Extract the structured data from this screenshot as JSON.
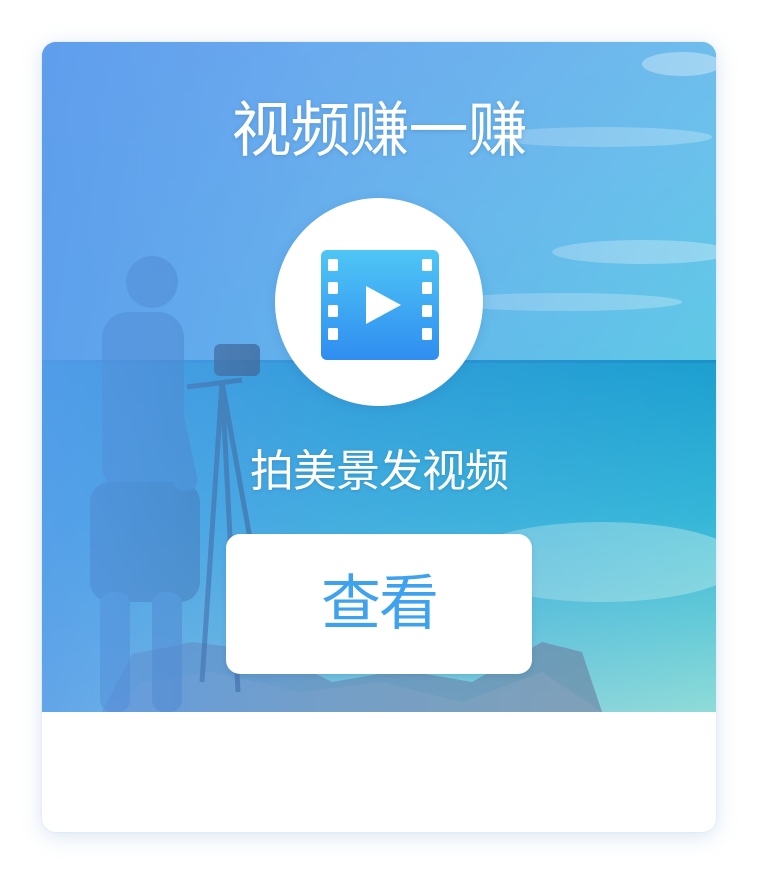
{
  "card": {
    "title": "视频赚一赚",
    "subtitle": "拍美景发视频",
    "button_label": "查看",
    "icon": "video-film-icon",
    "background_image": "photographer-at-seaside"
  },
  "colors": {
    "accent": "#3fa2ee",
    "icon_gradient_top": "#4fc6f5",
    "icon_gradient_bottom": "#2f8df0",
    "title_text": "#ffffff"
  }
}
